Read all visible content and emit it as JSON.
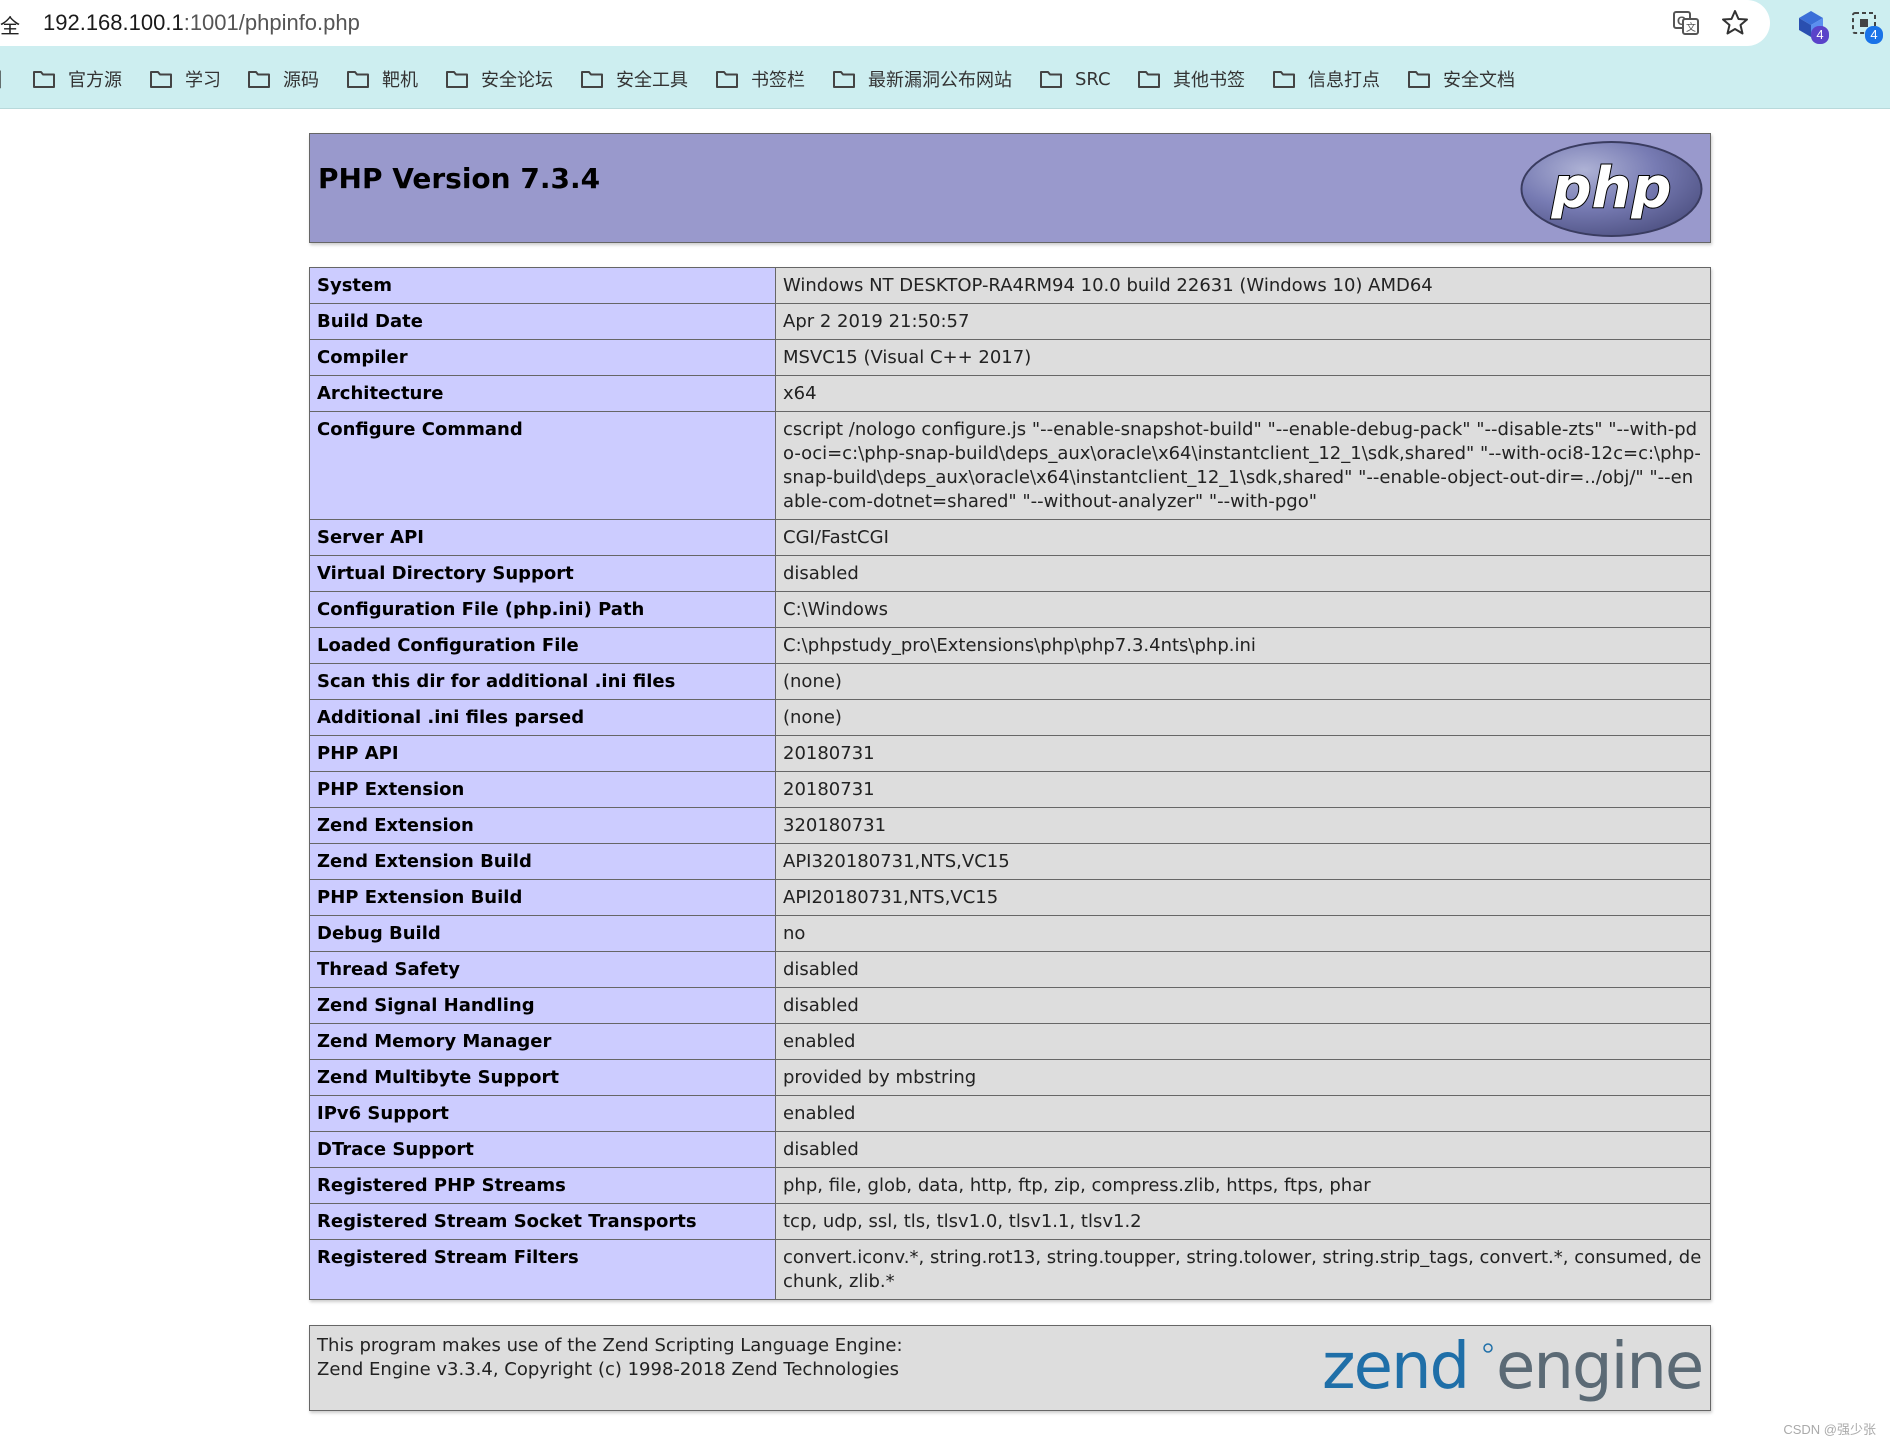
{
  "browser": {
    "security_label": "全",
    "url_host": "192.168.100.1",
    "url_port_path": ":1001/phpinfo.php",
    "extension_badge_1": "4",
    "extension_badge_2": "4"
  },
  "bookmarks": [
    {
      "label": "官方源"
    },
    {
      "label": "学习"
    },
    {
      "label": "源码"
    },
    {
      "label": "靶机"
    },
    {
      "label": "安全论坛"
    },
    {
      "label": "安全工具"
    },
    {
      "label": "书签栏"
    },
    {
      "label": "最新漏洞公布网站"
    },
    {
      "label": "SRC"
    },
    {
      "label": "其他书签"
    },
    {
      "label": "信息打点"
    },
    {
      "label": "安全文档"
    }
  ],
  "phpinfo": {
    "title": "PHP Version 7.3.4",
    "logo_text": "php",
    "rows": [
      {
        "key": "System",
        "value": "Windows NT DESKTOP-RA4RM94 10.0 build 22631 (Windows 10) AMD64"
      },
      {
        "key": "Build Date",
        "value": "Apr 2 2019 21:50:57"
      },
      {
        "key": "Compiler",
        "value": "MSVC15 (Visual C++ 2017)"
      },
      {
        "key": "Architecture",
        "value": "x64"
      },
      {
        "key": "Configure Command",
        "value": "cscript /nologo configure.js \"--enable-snapshot-build\" \"--enable-debug-pack\" \"--disable-zts\" \"--with-pdo-oci=c:\\php-snap-build\\deps_aux\\oracle\\x64\\instantclient_12_1\\sdk,shared\" \"--with-oci8-12c=c:\\php-snap-build\\deps_aux\\oracle\\x64\\instantclient_12_1\\sdk,shared\" \"--enable-object-out-dir=../obj/\" \"--enable-com-dotnet=shared\" \"--without-analyzer\" \"--with-pgo\""
      },
      {
        "key": "Server API",
        "value": "CGI/FastCGI"
      },
      {
        "key": "Virtual Directory Support",
        "value": "disabled"
      },
      {
        "key": "Configuration File (php.ini) Path",
        "value": "C:\\Windows"
      },
      {
        "key": "Loaded Configuration File",
        "value": "C:\\phpstudy_pro\\Extensions\\php\\php7.3.4nts\\php.ini"
      },
      {
        "key": "Scan this dir for additional .ini files",
        "value": "(none)"
      },
      {
        "key": "Additional .ini files parsed",
        "value": "(none)"
      },
      {
        "key": "PHP API",
        "value": "20180731"
      },
      {
        "key": "PHP Extension",
        "value": "20180731"
      },
      {
        "key": "Zend Extension",
        "value": "320180731"
      },
      {
        "key": "Zend Extension Build",
        "value": "API320180731,NTS,VC15"
      },
      {
        "key": "PHP Extension Build",
        "value": "API20180731,NTS,VC15"
      },
      {
        "key": "Debug Build",
        "value": "no"
      },
      {
        "key": "Thread Safety",
        "value": "disabled"
      },
      {
        "key": "Zend Signal Handling",
        "value": "disabled"
      },
      {
        "key": "Zend Memory Manager",
        "value": "enabled"
      },
      {
        "key": "Zend Multibyte Support",
        "value": "provided by mbstring"
      },
      {
        "key": "IPv6 Support",
        "value": "enabled"
      },
      {
        "key": "DTrace Support",
        "value": "disabled"
      },
      {
        "key": "Registered PHP Streams",
        "value": "php, file, glob, data, http, ftp, zip, compress.zlib, https, ftps, phar"
      },
      {
        "key": "Registered Stream Socket Transports",
        "value": "tcp, udp, ssl, tls, tlsv1.0, tlsv1.1, tlsv1.2"
      },
      {
        "key": "Registered Stream Filters",
        "value": "convert.iconv.*, string.rot13, string.toupper, string.tolower, string.strip_tags, convert.*, consumed, dechunk, zlib.*"
      }
    ]
  },
  "zend": {
    "line1": "This program makes use of the Zend Scripting Language Engine:",
    "line2": "Zend Engine v3.3.4, Copyright (c) 1998-2018 Zend Technologies",
    "logo_word1": "zend",
    "logo_word2": "engine"
  },
  "watermark": "CSDN @强少张",
  "colors": {
    "header_bg": "#9999cc",
    "key_bg": "#ccccff",
    "value_bg": "#dddddd",
    "chrome_bg": "#cdeef0",
    "zend_blue": "#1f6fa8",
    "zend_gray": "#5b6a75"
  }
}
